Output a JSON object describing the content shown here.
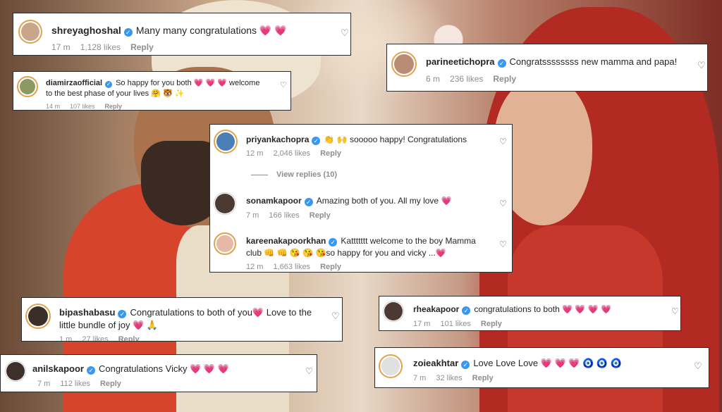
{
  "comments": {
    "shreya": {
      "username": "shreyaghoshal",
      "text": "Many many congratulations",
      "emojis": "💗 💗",
      "time": "17 m",
      "likes": "1,128 likes",
      "reply": "Reply"
    },
    "diamirza": {
      "username": "diamirzaofficial",
      "text": "So happy for you both",
      "emojis": "💗 💗 💗",
      "text2": "welcome",
      "line2": "to the best phase of your lives 🤗 🐯 ✨",
      "time": "14 m",
      "likes": "107 likes",
      "reply": "Reply"
    },
    "parineeti": {
      "username": "parineetichopra",
      "text": "Congratssssssss new mamma and papa!",
      "time": "6 m",
      "likes": "236 likes",
      "reply": "Reply"
    },
    "priyanka": {
      "username": "priyankachopra",
      "emojis": "👏 🙌",
      "text": "sooooo happy! Congratulations",
      "time": "12 m",
      "likes": "2,046 likes",
      "reply": "Reply",
      "view_replies": "View replies (10)"
    },
    "sonam": {
      "username": "sonamkapoor",
      "text": "Amazing both of you. All my love",
      "emojis": "💗",
      "time": "7 m",
      "likes": "166 likes",
      "reply": "Reply"
    },
    "kareena": {
      "username": "kareenakapoorkhan",
      "text": "Kattttttt welcome to the boy Mamma",
      "line2_pre": "club",
      "line2_emojis": "👊 👊 😘 😘 😘",
      "line2_post": "so happy for you and vicky ...",
      "line2_end": "💗",
      "time": "12 m",
      "likes": "1,663 likes",
      "reply": "Reply"
    },
    "bipasha": {
      "username": "bipashabasu",
      "text": "Congratulations to both of you",
      "emoji1": "💗",
      "text2": "Love to the",
      "line2": "little bundle of joy",
      "line2_emojis": "💗 🙏",
      "time": "1 m",
      "likes": "27 likes",
      "reply": "Reply"
    },
    "rhea": {
      "username": "rheakapoor",
      "text": "congratulations to both",
      "emojis": "💗 💗 💗 💗",
      "time": "17 m",
      "likes": "101 likes",
      "reply": "Reply"
    },
    "anil": {
      "username": "anilskapoor",
      "text": "Congratulations Vicky",
      "emojis": "💗 💗 💗",
      "time": "7 m",
      "likes": "112 likes",
      "reply": "Reply"
    },
    "zoya": {
      "username": "zoieakhtar",
      "text": "Love Love Love",
      "emojis": "💗 💗 💗 🧿 🧿 🧿",
      "time": "7 m",
      "likes": "32 likes",
      "reply": "Reply"
    }
  },
  "icons": {
    "like": "heart-outline-icon",
    "verified": "verified-badge-icon"
  },
  "colors": {
    "verified_blue": "#3897f0",
    "story_ring": "#e4a14a",
    "meta_gray": "#8e8e8e",
    "heart_pink": "#e0245e"
  }
}
